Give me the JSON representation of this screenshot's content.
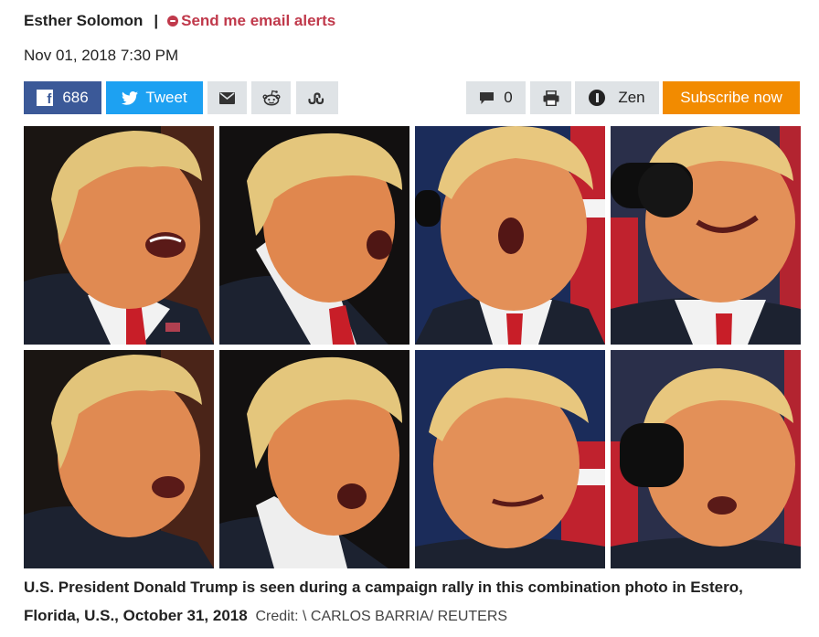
{
  "byline": {
    "author": "Esther Solomon",
    "separator": "|",
    "alerts_label": "Send me email alerts"
  },
  "date": "Nov 01, 2018 7:30 PM",
  "toolbar": {
    "facebook_count": "686",
    "tweet_label": "Tweet",
    "comments_count": "0",
    "zen_label": "Zen",
    "subscribe_label": "Subscribe now",
    "colors": {
      "facebook": "#3b5998",
      "twitter": "#1da1f2",
      "neutral": "#dfe3e6",
      "subscribe": "#f28b00",
      "alerts": "#c0394b"
    }
  },
  "photo_grid": {
    "rows": 2,
    "columns": 4
  },
  "caption": {
    "text": "U.S. President Donald Trump is seen during a campaign rally in this combination photo in Estero, Florida, U.S., October 31, 2018",
    "credit": "Credit: \\ CARLOS BARRIA/ REUTERS"
  }
}
